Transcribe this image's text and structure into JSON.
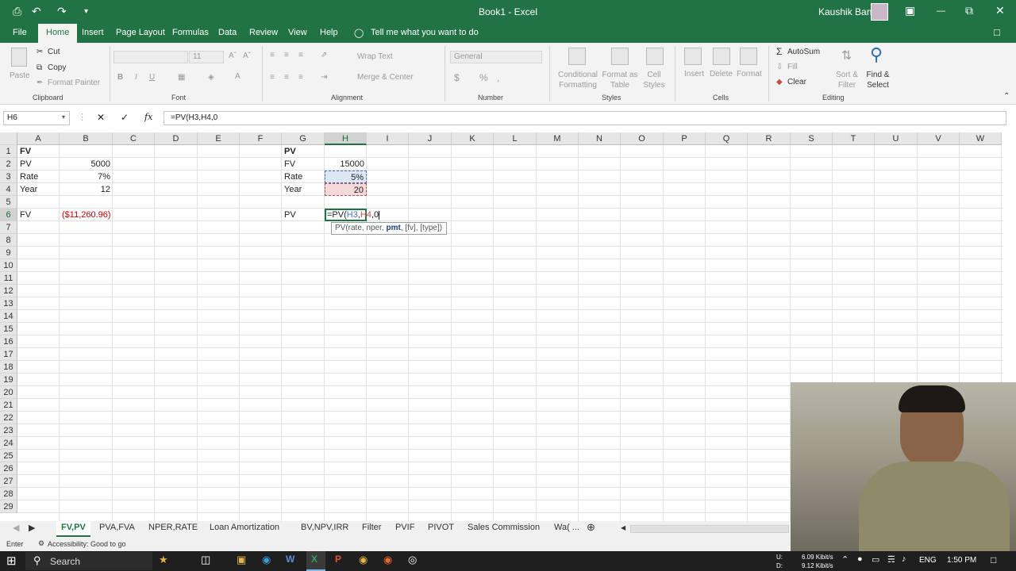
{
  "titlebar": {
    "title": "Book1  -  Excel",
    "user": "Kaushik Banik",
    "save_icon": "⎙",
    "undo_icon": "↶",
    "redo_icon": "↷",
    "customize_icon": "▾",
    "ribbon_opts_icon": "▣",
    "minimize_icon": "—",
    "restore_icon": "⧉",
    "close_icon": "✕"
  },
  "tabs": [
    "File",
    "Home",
    "Insert",
    "Page Layout",
    "Formulas",
    "Data",
    "Review",
    "View",
    "Help"
  ],
  "tell_me": "Tell me what you want to do",
  "ribbon": {
    "clipboard": {
      "paste": "Paste",
      "cut": "Cut",
      "copy": "Copy",
      "format_painter": "Format Painter",
      "label": "Clipboard"
    },
    "font": {
      "size": "11",
      "bold": "B",
      "italic": "I",
      "underline": "U",
      "label": "Font"
    },
    "alignment": {
      "wrap": "Wrap Text",
      "merge": "Merge & Center",
      "label": "Alignment"
    },
    "number": {
      "format": "General",
      "dollar": "$",
      "percent": "%",
      "comma": ",",
      "label": "Number"
    },
    "styles": {
      "conditional": "Conditional Formatting",
      "format_table": "Format as Table",
      "cell_styles": "Cell Styles",
      "label": "Styles"
    },
    "cells": {
      "insert": "Insert",
      "delete": "Delete",
      "format": "Format",
      "label": "Cells"
    },
    "editing": {
      "autosum": "AutoSum",
      "fill": "Fill",
      "clear": "Clear",
      "sort": "Sort & Filter",
      "find": "Find & Select",
      "label": "Editing"
    }
  },
  "formula_bar": {
    "name_box": "H6",
    "formula": "=PV(H3,H4,0",
    "cancel": "✕",
    "enter": "✓",
    "fx": "fx"
  },
  "columns": [
    "A",
    "B",
    "C",
    "D",
    "E",
    "F",
    "G",
    "H",
    "I",
    "J",
    "K",
    "L",
    "M",
    "N",
    "O",
    "P",
    "Q",
    "R",
    "S",
    "T",
    "U",
    "V",
    "W"
  ],
  "rows": [
    "1",
    "2",
    "3",
    "4",
    "5",
    "6",
    "7",
    "8",
    "9",
    "10",
    "11",
    "12",
    "13",
    "14",
    "15",
    "16",
    "17",
    "18",
    "19",
    "20",
    "21",
    "22",
    "23",
    "24",
    "25",
    "26",
    "27",
    "28",
    "29"
  ],
  "cells": {
    "A1": "FV",
    "A2": "PV",
    "B2": "5000",
    "A3": "Rate",
    "B3": "7%",
    "A4": "Year",
    "B4": "12",
    "A6": "FV",
    "B6": "($11,260.96)",
    "G1": "PV",
    "G2": "FV",
    "H2": "15000",
    "G3": "Rate",
    "H3": "5%",
    "G4": "Year",
    "H4": "20",
    "G6": "PV",
    "H6_a": "=PV(",
    "H6_b": "H3",
    "H6_c": ",",
    "H6_d": "H4",
    "H6_e": ",0"
  },
  "tooltip": {
    "a": "PV(rate, nper, ",
    "b": "pmt",
    "c": ", [fv], [type])"
  },
  "sheet_tabs": [
    "FV,PV",
    "PVA,FVA",
    "NPER,RATE",
    "Loan Amortization",
    "BV,NPV,IRR",
    "Filter",
    "PVIF",
    "PIVOT",
    "Sales Commission",
    "Wa( ..."
  ],
  "status": {
    "mode": "Enter",
    "accessibility": "Accessibility: Good to go"
  },
  "taskbar": {
    "search": "Search",
    "lang": "ENG",
    "time": "1:50 PM",
    "net_up": "6.09 Kibit/s",
    "net_down": "9.12 Kibit/s",
    "net_u": "U:",
    "net_d": "D:"
  },
  "colors": {
    "excel_green": "#217346",
    "negative_red": "#c00000",
    "ref_blue": "#4472c4",
    "ref_red": "#c0504d"
  }
}
